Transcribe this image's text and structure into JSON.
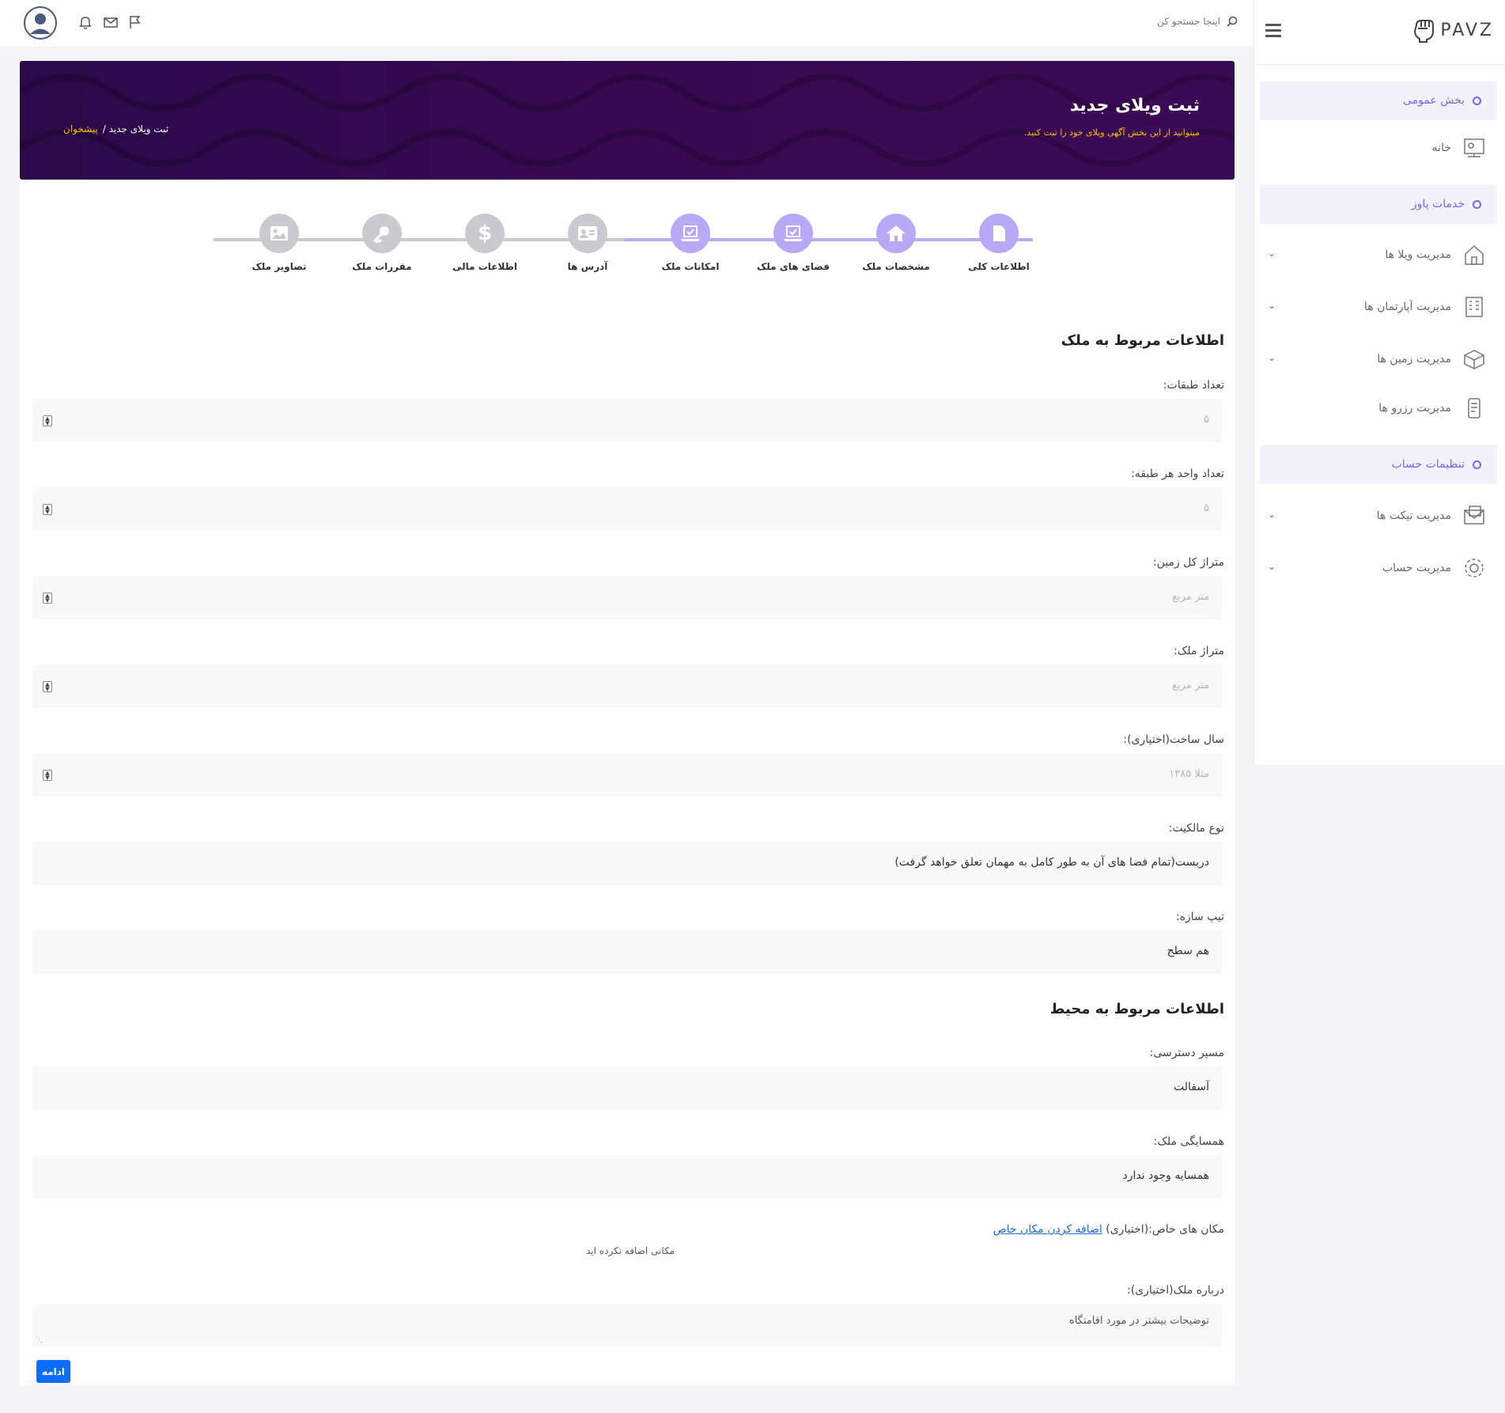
{
  "brand": {
    "name": "PAVZ"
  },
  "topbar": {
    "search_placeholder": "اینجا جستجو کن"
  },
  "sidebar": {
    "sections": [
      {
        "title": "بخش عمومی"
      },
      {
        "title": "خدمات پاوز"
      },
      {
        "title": "تنظیمات حساب"
      }
    ],
    "items": [
      {
        "label": "خانه",
        "icon": "home-icon"
      },
      {
        "label": "مدیریت ویلا ها",
        "icon": "villa-icon"
      },
      {
        "label": "مدیریت آپارتمان ها",
        "icon": "apartment-icon"
      },
      {
        "label": "مدیریت زمین ها",
        "icon": "land-icon"
      },
      {
        "label": "مدیریت رزرو ها",
        "icon": "reservation-icon"
      },
      {
        "label": "مدیریت تیکت ها",
        "icon": "ticket-icon"
      },
      {
        "label": "مدیریت حساب",
        "icon": "settings-gear-icon"
      }
    ]
  },
  "header": {
    "title": "ثبت ویلای جدید",
    "subtitle": "میتوانید از این بخش آگهی ویلای خود را ثبت کنید.",
    "breadcrumb_home": "پیشخوان",
    "breadcrumb_current": "ثبت ویلای جدید /"
  },
  "steps": [
    {
      "label": "اطلاعات کلی",
      "state": "active",
      "icon": "document-icon"
    },
    {
      "label": "مشخصات ملک",
      "state": "active",
      "icon": "house-icon"
    },
    {
      "label": "فضای های ملک",
      "state": "active",
      "icon": "laptop-check-icon"
    },
    {
      "label": "امکانات ملک",
      "state": "active",
      "icon": "laptop-check-icon"
    },
    {
      "label": "آدرس ها",
      "state": "inactive",
      "icon": "address-card-icon"
    },
    {
      "label": "اطلاعات مالی",
      "state": "inactive",
      "icon": "dollar-icon"
    },
    {
      "label": "مقررات ملک",
      "state": "inactive",
      "icon": "key-icon"
    },
    {
      "label": "تصاویر ملک",
      "state": "inactive",
      "icon": "image-icon"
    }
  ],
  "form": {
    "property_heading": "اطلاعات مربوط به ملک",
    "floors": {
      "label": "تعداد طبقات:",
      "placeholder": "۵"
    },
    "units": {
      "label": "تعداد واحد هر طبقه:",
      "placeholder": "۵"
    },
    "land_area": {
      "label": "متراژ کل زمین:",
      "placeholder": "متر مربع"
    },
    "property_area": {
      "label": "متراژ ملک:",
      "placeholder": "متر مربع"
    },
    "build_year": {
      "label": "سال ساخت(اختیاری):",
      "placeholder": "مثلا ۱۳۸۵"
    },
    "ownership": {
      "label": "نوع مالکیت:",
      "value": "دربست(تمام فضا های آن به طور کامل به مهمان تعلق خواهد گرفت)"
    },
    "structure": {
      "label": "تیپ سازه:",
      "value": "هم سطح"
    },
    "env_heading": "اطلاعات مربوط به محیط",
    "access": {
      "label": "مسیر دسترسی:",
      "value": "آسفالت"
    },
    "neighbors": {
      "label": "همسایگی ملک:",
      "value": "همسایه وجود ندارد"
    },
    "special_places": {
      "label": "مکان های خاص:(اختیاری)",
      "link": "اضافه کردن مکان خاص",
      "empty_note": "مکانی اضافه نکرده اید"
    },
    "about": {
      "label": "درباره ملک(اختیاری):",
      "placeholder": "توضیحات بیشتر در مورد اقامتگاه"
    },
    "submit_label": "ادامه"
  },
  "colors": {
    "accent": "#7367f0",
    "step_active": "#b8a8f5",
    "step_inactive": "#c9c9cf",
    "banner": "#380950",
    "highlight": "#ffc107",
    "button": "#0d6efd"
  }
}
